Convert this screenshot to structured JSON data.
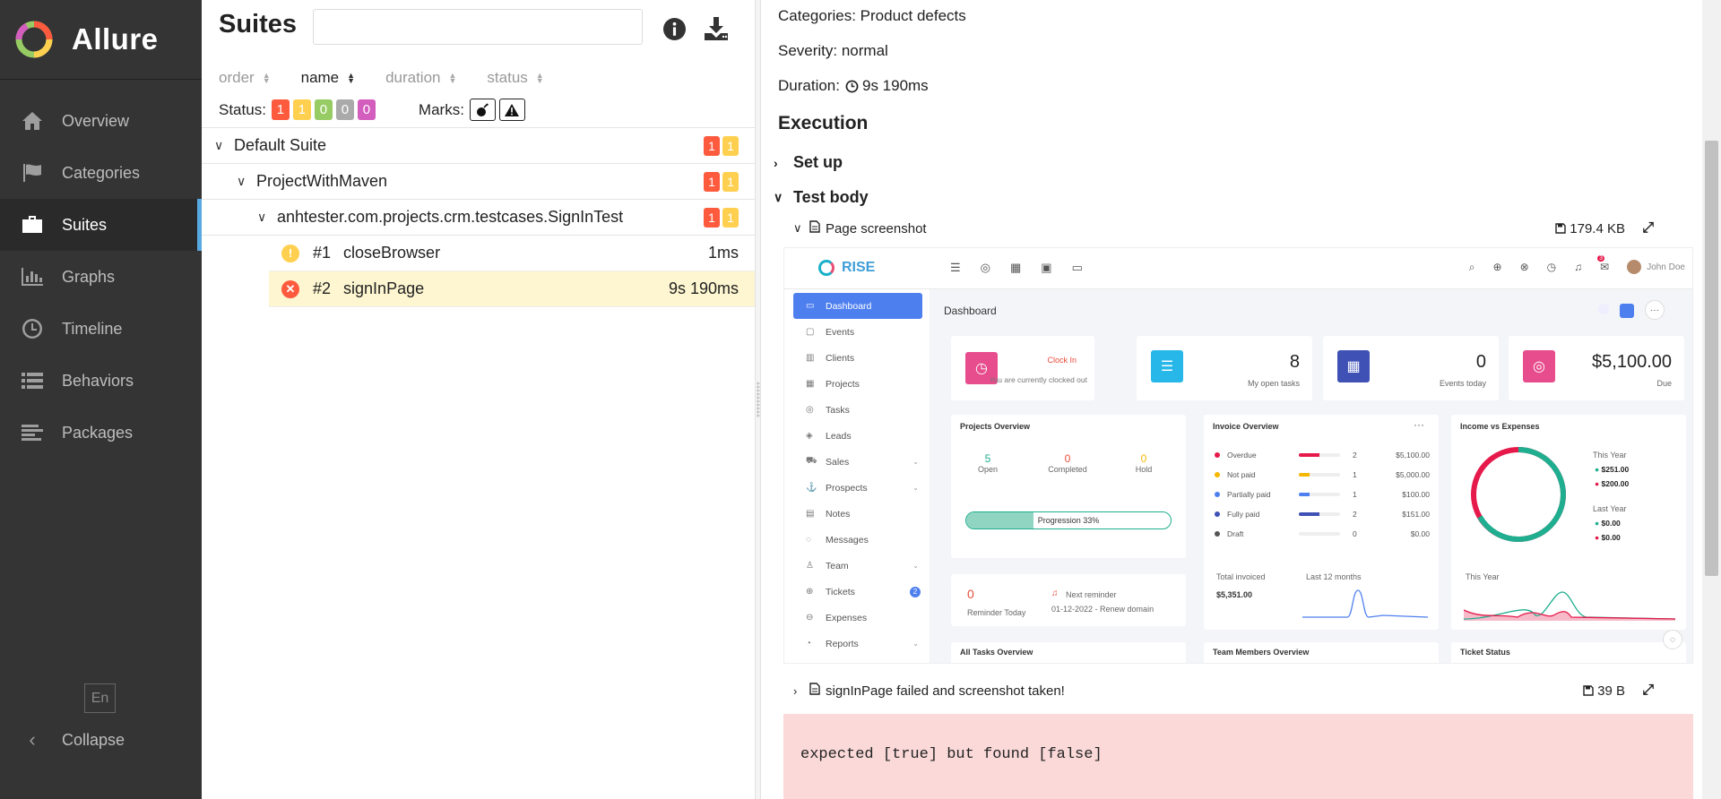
{
  "app": {
    "name": "Allure"
  },
  "sidebar": {
    "items": [
      {
        "label": "Overview",
        "icon": "home-icon"
      },
      {
        "label": "Categories",
        "icon": "flag-icon"
      },
      {
        "label": "Suites",
        "icon": "briefcase-icon",
        "active": true
      },
      {
        "label": "Graphs",
        "icon": "bar-chart-icon"
      },
      {
        "label": "Timeline",
        "icon": "clock-icon"
      },
      {
        "label": "Behaviors",
        "icon": "list-icon"
      },
      {
        "label": "Packages",
        "icon": "align-left-icon"
      }
    ],
    "lang": "En",
    "collapse": "Collapse"
  },
  "suites": {
    "title": "Suites",
    "search_value": "",
    "sorters": {
      "order": "order",
      "name": "name",
      "duration": "duration",
      "status": "status"
    },
    "status_label": "Status:",
    "status_counts": {
      "failed": "1",
      "broken": "1",
      "passed": "0",
      "skipped": "0",
      "unknown": "0"
    },
    "marks_label": "Marks:",
    "tree": {
      "suite": {
        "name": "Default Suite",
        "failed": "1",
        "broken": "1"
      },
      "project": {
        "name": "ProjectWithMaven",
        "failed": "1",
        "broken": "1"
      },
      "class": {
        "name": "anhtester.com.projects.crm.testcases.SignInTest",
        "failed": "1",
        "broken": "1"
      },
      "cases": [
        {
          "num": "#1",
          "name": "closeBrowser",
          "duration": "1ms",
          "status": "broken",
          "status_color": "#ffd050"
        },
        {
          "num": "#2",
          "name": "signInPage",
          "duration": "9s 190ms",
          "status": "failed",
          "status_color": "#fd5a3e"
        }
      ]
    }
  },
  "details": {
    "categories": "Categories: Product defects",
    "severity": "Severity: normal",
    "duration_label": "Duration:",
    "duration": "9s 190ms",
    "execution": "Execution",
    "setup": "Set up",
    "test_body": "Test body",
    "attachment1": {
      "name": "Page screenshot",
      "size": "179.4 KB"
    },
    "attachment2": {
      "name": "signInPage failed and screenshot taken!",
      "size": "39 B"
    },
    "error": "expected [true] but found [false]"
  },
  "screenshot": {
    "brand": "RISE",
    "user": "John Doe",
    "notif_count": "3",
    "nav": [
      {
        "label": "Dashboard",
        "active": true
      },
      {
        "label": "Events"
      },
      {
        "label": "Clients"
      },
      {
        "label": "Projects"
      },
      {
        "label": "Tasks"
      },
      {
        "label": "Leads"
      },
      {
        "label": "Sales",
        "dd": true
      },
      {
        "label": "Prospects",
        "dd": true
      },
      {
        "label": "Notes"
      },
      {
        "label": "Messages"
      },
      {
        "label": "Team",
        "dd": true
      },
      {
        "label": "Tickets",
        "badge": "2"
      },
      {
        "label": "Expenses"
      },
      {
        "label": "Reports",
        "dd": true
      }
    ],
    "dashboard_title": "Dashboard",
    "clock": {
      "link": "Clock In",
      "text": "You are currently clocked out"
    },
    "tasks": {
      "value": "8",
      "label": "My open tasks"
    },
    "events": {
      "value": "0",
      "label": "Events today"
    },
    "due": {
      "value": "$5,100.00",
      "label": "Due"
    },
    "projects": {
      "title": "Projects Overview",
      "open": "5",
      "open_label": "Open",
      "completed": "0",
      "completed_label": "Completed",
      "hold": "0",
      "hold_label": "Hold",
      "progress_label": "Progression 33%",
      "progress": 0.33
    },
    "invoice": {
      "title": "Invoice Overview",
      "rows": [
        {
          "label": "Overdue",
          "count": "2",
          "amount": "$5,100.00",
          "color": "#e6194b",
          "fill": 0.5
        },
        {
          "label": "Not paid",
          "count": "1",
          "amount": "$5,000.00",
          "color": "#f5b700",
          "fill": 0.25
        },
        {
          "label": "Partially paid",
          "count": "1",
          "amount": "$100.00",
          "color": "#4e7fef",
          "fill": 0.25
        },
        {
          "label": "Fully paid",
          "count": "2",
          "amount": "$151.00",
          "color": "#3f51b5",
          "fill": 0.5
        },
        {
          "label": "Draft",
          "count": "0",
          "amount": "$0.00",
          "color": "#555555",
          "fill": 0
        }
      ],
      "total_label": "Total invoiced",
      "total": "$5,351.00",
      "last12": "Last 12 months"
    },
    "income": {
      "title": "Income vs Expenses",
      "this_year": "This Year",
      "this_income": "$251.00",
      "this_expense": "$200.00",
      "last_year": "Last Year",
      "last_income": "$0.00",
      "last_expense": "$0.00",
      "chart_label": "This Year"
    },
    "reminder": {
      "value": "0",
      "label": "Reminder Today",
      "next": "Next reminder",
      "date": "01-12-2022 - Renew domain"
    },
    "bottom": {
      "tasks": "All Tasks Overview",
      "team": "Team Members Overview",
      "tickets": "Ticket Status"
    }
  }
}
